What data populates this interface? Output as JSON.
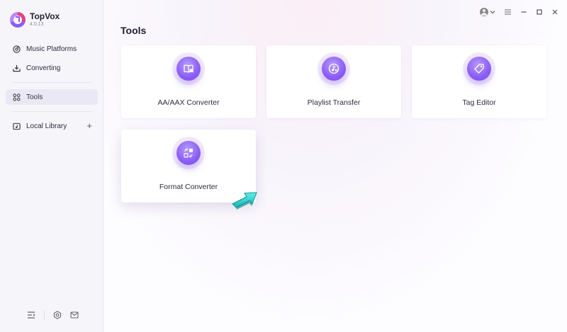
{
  "app": {
    "name": "TopVox",
    "version": "4.0.13"
  },
  "sidebar": {
    "items": [
      {
        "label": "Music Platforms",
        "icon": "music-platforms-icon"
      },
      {
        "label": "Converting",
        "icon": "download-icon"
      },
      {
        "label": "Tools",
        "icon": "grid-icon",
        "active": true
      },
      {
        "label": "Local Library",
        "icon": "library-icon"
      }
    ],
    "add_symbol": "+",
    "bottom_icons": [
      "collapse-icon",
      "settings-icon",
      "mail-icon"
    ]
  },
  "main": {
    "title": "Tools",
    "tools": [
      {
        "label": "AA/AAX Converter",
        "icon": "book-convert-icon"
      },
      {
        "label": "Playlist Transfer",
        "icon": "playlist-icon"
      },
      {
        "label": "Tag Editor",
        "icon": "tag-icon"
      },
      {
        "label": "Format Converter",
        "icon": "format-convert-icon"
      }
    ]
  },
  "titlebar": {
    "icons": [
      "user-icon",
      "chevron-down-icon",
      "menu-icon",
      "minimize-icon",
      "maximize-icon",
      "close-icon"
    ]
  },
  "colors": {
    "accent": "#8b5cf6",
    "arrow": "#2ed3d1"
  }
}
